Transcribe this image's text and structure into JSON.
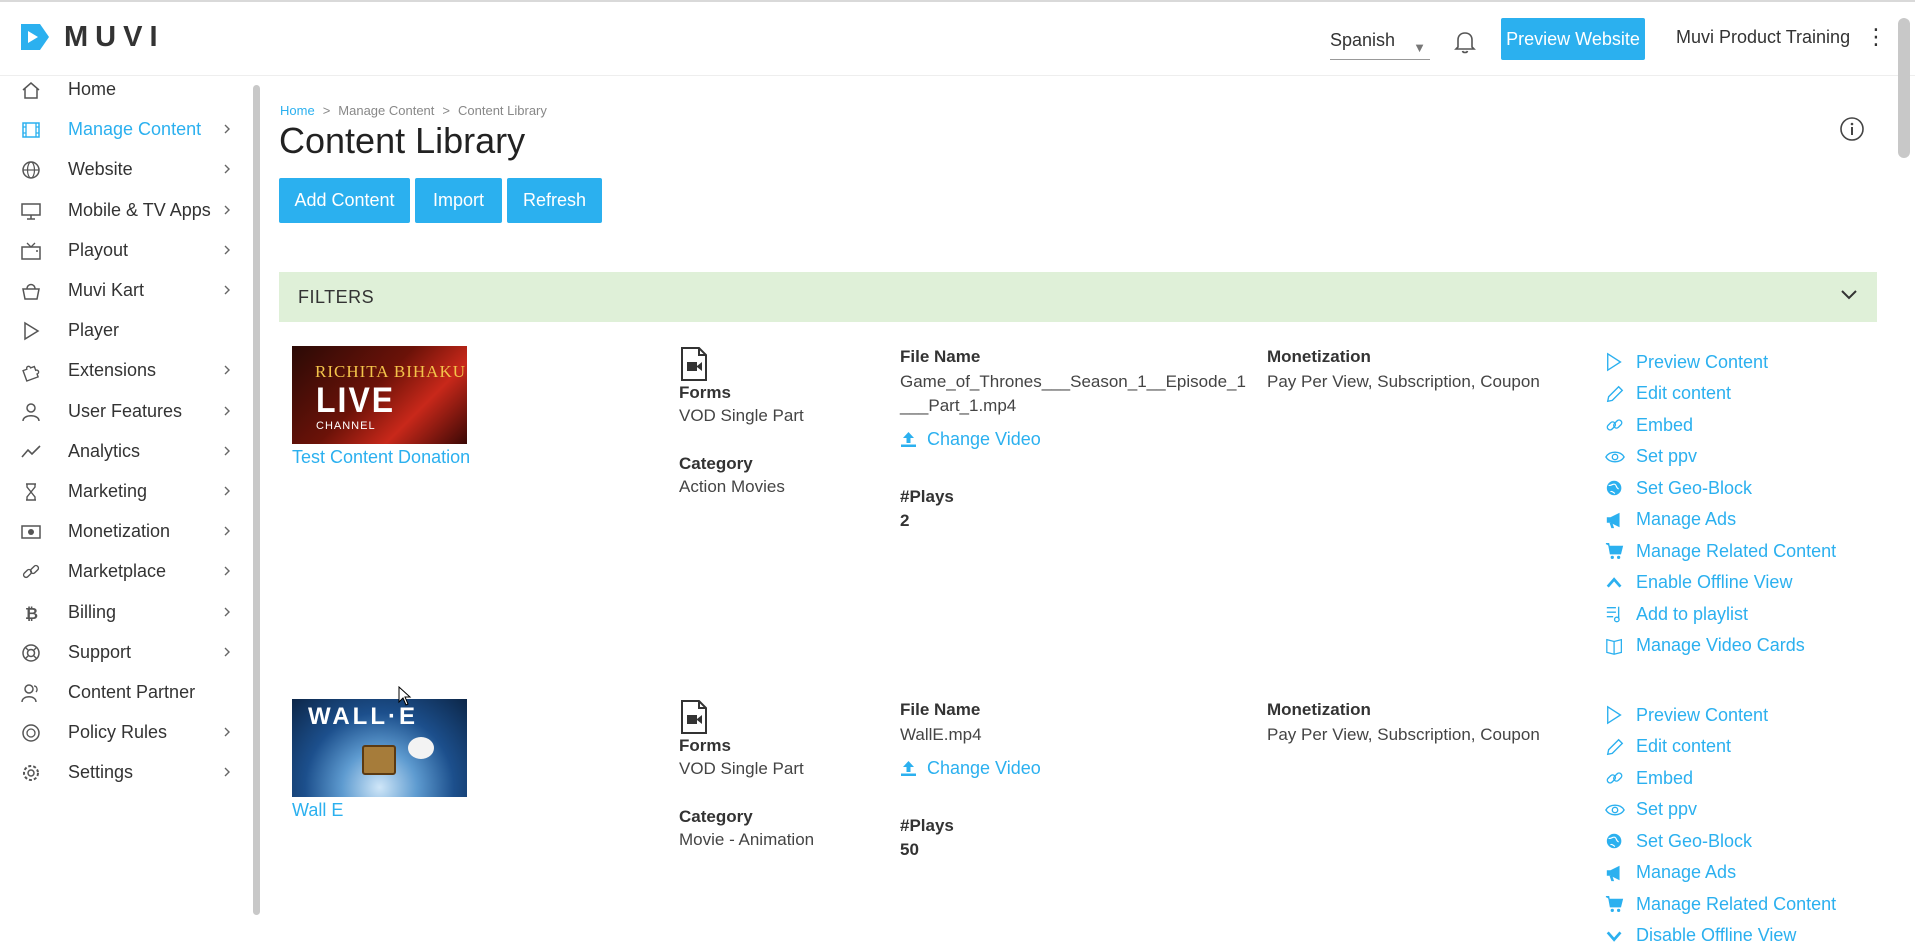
{
  "header": {
    "logo_text": "MUVI",
    "language": "Spanish",
    "preview_button": "Preview Website",
    "account_name": "Muvi Product Training",
    "accent_color": "#2bb0ef"
  },
  "sidebar": {
    "items": [
      {
        "label": "Home",
        "icon": "home-icon",
        "has_chevron": false
      },
      {
        "label": "Manage Content",
        "icon": "film-icon",
        "has_chevron": true,
        "active": true
      },
      {
        "label": "Website",
        "icon": "globe-icon",
        "has_chevron": true
      },
      {
        "label": "Mobile & TV Apps",
        "icon": "monitor-icon",
        "has_chevron": true
      },
      {
        "label": "Playout",
        "icon": "tv-icon",
        "has_chevron": true
      },
      {
        "label": "Muvi Kart",
        "icon": "bag-icon",
        "has_chevron": true
      },
      {
        "label": "Player",
        "icon": "play-icon",
        "has_chevron": false
      },
      {
        "label": "Extensions",
        "icon": "puzzle-icon",
        "has_chevron": true
      },
      {
        "label": "User Features",
        "icon": "user-icon",
        "has_chevron": true
      },
      {
        "label": "Analytics",
        "icon": "chart-line-icon",
        "has_chevron": true
      },
      {
        "label": "Marketing",
        "icon": "hourglass-icon",
        "has_chevron": true
      },
      {
        "label": "Monetization",
        "icon": "money-icon",
        "has_chevron": true
      },
      {
        "label": "Marketplace",
        "icon": "link-icon",
        "has_chevron": true
      },
      {
        "label": "Billing",
        "icon": "bitcoin-icon",
        "has_chevron": true
      },
      {
        "label": "Support",
        "icon": "lifebuoy-icon",
        "has_chevron": true
      },
      {
        "label": "Content Partner",
        "icon": "partner-icon",
        "has_chevron": false
      },
      {
        "label": "Policy Rules",
        "icon": "policy-icon",
        "has_chevron": true
      },
      {
        "label": "Settings",
        "icon": "gear-icon",
        "has_chevron": true
      }
    ]
  },
  "breadcrumb": {
    "home": "Home",
    "sep": ">",
    "manage": "Manage Content",
    "current": "Content Library"
  },
  "page_title": "Content Library",
  "toolbar": {
    "add": "Add Content",
    "import": "Import",
    "refresh": "Refresh"
  },
  "filters": {
    "label": "FILTERS"
  },
  "labels": {
    "forms": "Forms",
    "category": "Category",
    "file_name": "File Name",
    "plays": "#Plays",
    "monetization": "Monetization",
    "change_video": "Change Video"
  },
  "contents": [
    {
      "title": "Test Content Donation",
      "thumb_text_1": "RICHITA BIHAKU",
      "thumb_text_2": "LIVE",
      "thumb_text_3": "CHANNEL",
      "form": "VOD Single Part",
      "category": "Action Movies",
      "file_name_1": "Game_of_Thrones___Season_1__Episode_1",
      "file_name_2": "___Part_1.mp4",
      "plays": "2",
      "monetization": "Pay Per View, Subscription, Coupon",
      "actions": [
        "Preview Content",
        "Edit content",
        "Embed",
        "Set ppv",
        "Set Geo-Block",
        "Manage Ads",
        "Manage Related Content",
        "Enable Offline View",
        "Add to playlist",
        "Manage Video Cards"
      ]
    },
    {
      "title": "Wall E",
      "thumb_text_1": "WALL·E",
      "form": "VOD Single Part",
      "category": "Movie - Animation",
      "file_name_1": "WallE.mp4",
      "plays": "50",
      "monetization": "Pay Per View, Subscription, Coupon",
      "actions": [
        "Preview Content",
        "Edit content",
        "Embed",
        "Set ppv",
        "Set Geo-Block",
        "Manage Ads",
        "Manage Related Content",
        "Disable Offline View"
      ]
    }
  ]
}
